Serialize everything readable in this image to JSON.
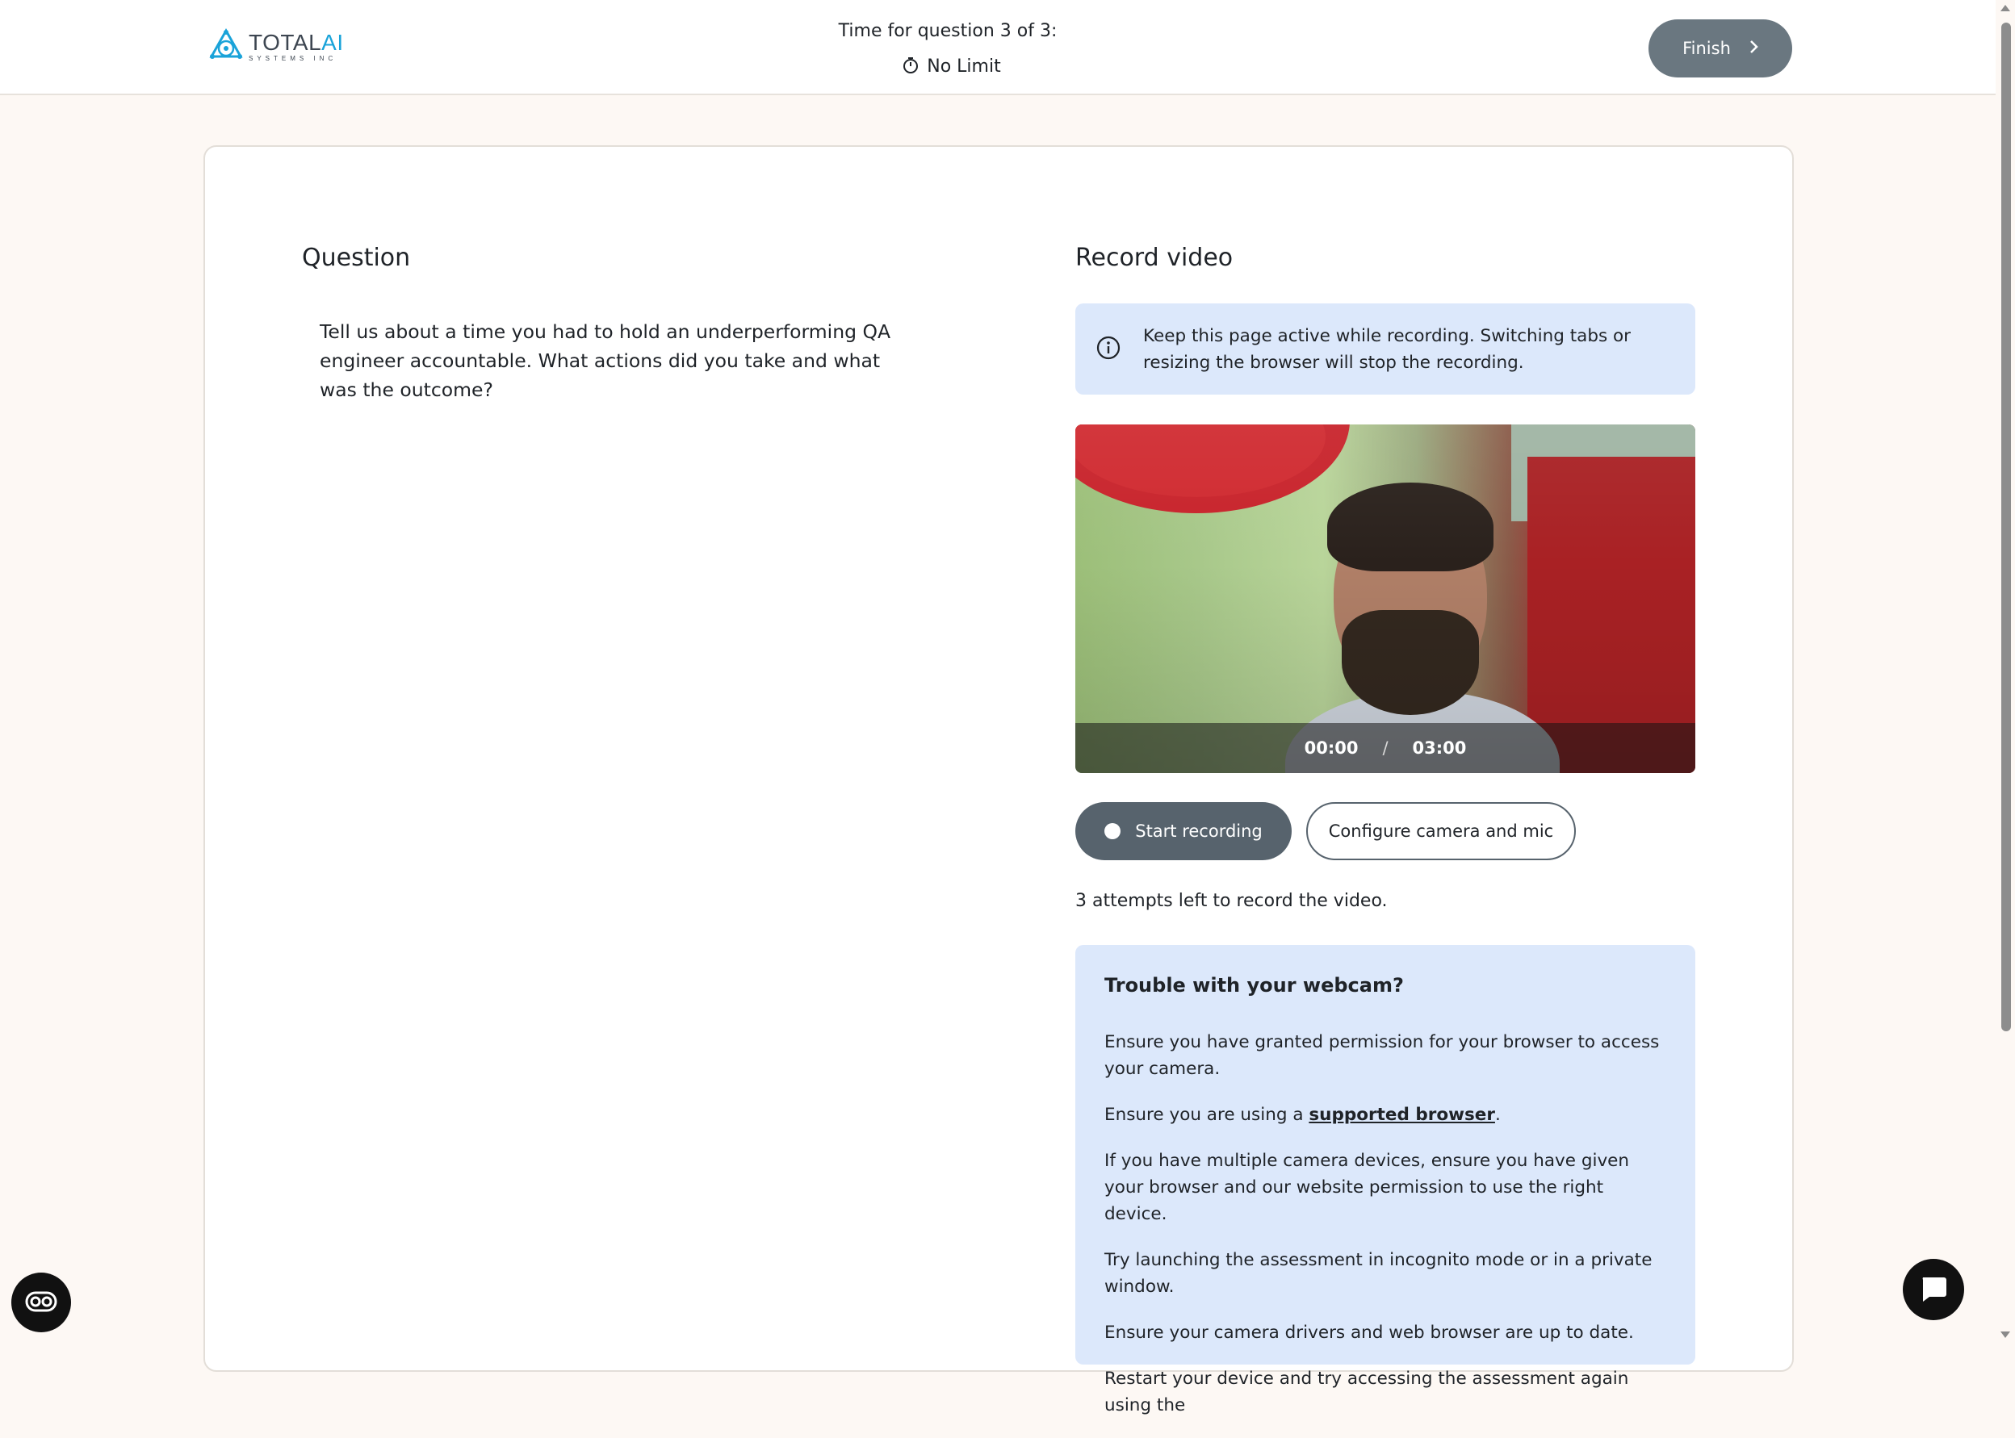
{
  "header": {
    "logo": {
      "brand_main": "TOTAL",
      "brand_accent": "AI",
      "brand_sub": "SYSTEMS INC",
      "icon": "total-ai-logo-icon",
      "accent_color": "#1aa3d9"
    },
    "timer_title": "Time for question 3 of 3:",
    "timer_icon": "stopwatch-icon",
    "timer_limit": "No Limit",
    "finish_label": "Finish",
    "finish_icon": "chevron-right-icon"
  },
  "question": {
    "heading": "Question",
    "text": "Tell us about a time you had to hold an underperforming QA engineer accountable. What actions did you take and what was the outcome?"
  },
  "record": {
    "heading": "Record video",
    "info_icon": "info-icon",
    "info_text": "Keep this page active while recording. Switching tabs or resizing the browser will stop the recording.",
    "time_current": "00:00",
    "time_separator": "/",
    "time_total": "03:00",
    "start_label": "Start recording",
    "configure_label": "Configure camera and mic",
    "attempts_text": "3 attempts left to record the video."
  },
  "trouble": {
    "title": "Trouble with your webcam?",
    "item1": "Ensure you have granted permission for your browser to access your camera.",
    "item2_prefix": "Ensure you are using a ",
    "item2_link": "supported browser",
    "item2_suffix": ".",
    "item3": "If you have multiple camera devices, ensure you have given your browser and our website permission to use the right device.",
    "item4": "Try launching the assessment in incognito mode or in a private window.",
    "item5": "Ensure your camera drivers and web browser are up to date.",
    "item6": "Restart your device and try accessing the assessment again using the"
  },
  "widgets": {
    "accessibility_icon": "accessibility-icon",
    "chat_icon": "chat-icon"
  },
  "colors": {
    "page_bg": "#fdf8f4",
    "info_bg": "#dce8fb",
    "finish_bg": "#6a7780",
    "start_bg": "#57636d"
  }
}
